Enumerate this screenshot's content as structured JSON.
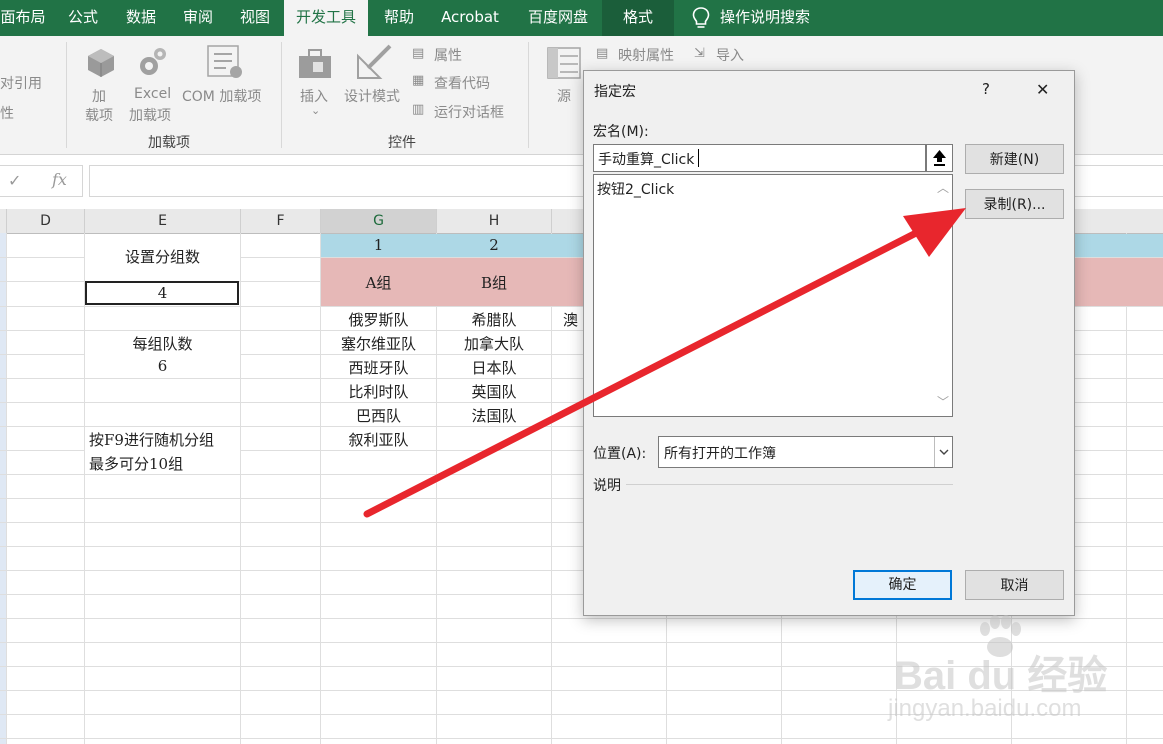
{
  "ribbon_tabs": [
    {
      "label": "面布局"
    },
    {
      "label": "公式"
    },
    {
      "label": "数据"
    },
    {
      "label": "审阅"
    },
    {
      "label": "视图"
    },
    {
      "label": "开发工具"
    },
    {
      "label": "帮助"
    },
    {
      "label": "Acrobat"
    },
    {
      "label": "百度网盘"
    },
    {
      "label": "格式"
    },
    {
      "label": "操作说明搜索"
    }
  ],
  "ribbon": {
    "left_partial": [
      "对引用",
      "性"
    ],
    "addins": {
      "add_line1": "加",
      "add_line2": "载项",
      "excel_line1": "Excel",
      "excel_line2": "加载项",
      "com": "COM 加载项",
      "group_label": "加载项"
    },
    "controls": {
      "insert": "插入",
      "design_mode": "设计模式",
      "properties": "属性",
      "view_code": "查看代码",
      "run_dialog": "运行对话框",
      "group_label": "控件"
    },
    "xml": {
      "source": "源",
      "map_props": "映射属性",
      "import": "导入"
    }
  },
  "formula_bar": {
    "fx": "fx",
    "value": ""
  },
  "sheet": {
    "columns": [
      "D",
      "E",
      "F",
      "G",
      "H"
    ],
    "e_cells": {
      "label_groups": "设置分组数",
      "groups_value": "4",
      "label_per_group": "每组队数",
      "per_group_value": "6",
      "note1": "按F9进行随机分组",
      "note2": "最多可分10组"
    },
    "group_numbers": [
      "1",
      "2"
    ],
    "group_names": [
      "A组",
      "B组"
    ],
    "group_a": [
      "俄罗斯队",
      "塞尔维亚队",
      "西班牙队",
      "比利时队",
      "巴西队",
      "叙利亚队"
    ],
    "group_b": [
      "希腊队",
      "加拿大队",
      "日本队",
      "英国队",
      "法国队"
    ],
    "partial_c_first": "澳"
  },
  "dialog": {
    "title": "指定宏",
    "help": "?",
    "close": "✕",
    "macro_name_label": "宏名(M):",
    "macro_name_value": "手动重算_Click",
    "macro_list": [
      "按钮2_Click"
    ],
    "new_button": "新建(N)",
    "record_button": "录制(R)...",
    "location_label": "位置(A):",
    "location_value": "所有打开的工作簿",
    "description_label": "说明",
    "ok_button": "确定",
    "cancel_button": "取消"
  },
  "watermark": {
    "brand": "Bai du 经验",
    "url": "jingyan.baidu.com"
  },
  "colors": {
    "excel_green": "#217346",
    "header_blue": "#add8e6",
    "header_pink": "#e6b8b7",
    "arrow_red": "#e8262d"
  }
}
